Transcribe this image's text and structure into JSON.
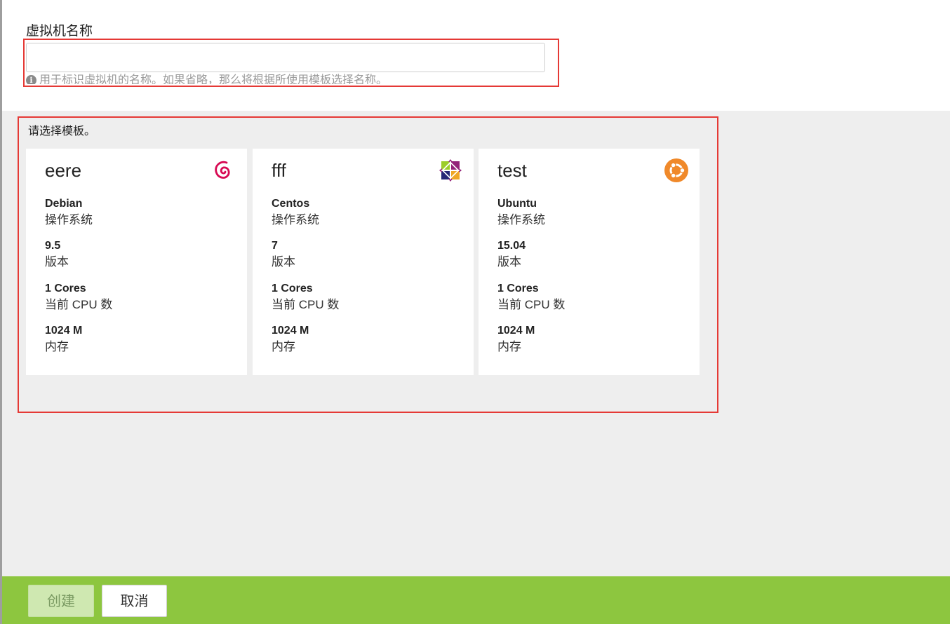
{
  "form": {
    "name_label": "虚拟机名称",
    "name_value": "",
    "name_placeholder": "",
    "hint_icon": "info-icon",
    "hint_text": "用于标识虚拟机的名称。如果省略，那么将根据所使用模板选择名称。"
  },
  "templates": {
    "prompt": "请选择模板。",
    "cards": [
      {
        "name": "eere",
        "icon": "debian-icon",
        "os": "Debian",
        "os_label": "操作系统",
        "version": "9.5",
        "version_label": "版本",
        "cpu": "1 Cores",
        "cpu_label": "当前 CPU 数",
        "memory": "1024 M",
        "memory_label": "内存"
      },
      {
        "name": "fff",
        "icon": "centos-icon",
        "os": "Centos",
        "os_label": "操作系统",
        "version": "7",
        "version_label": "版本",
        "cpu": "1 Cores",
        "cpu_label": "当前 CPU 数",
        "memory": "1024 M",
        "memory_label": "内存"
      },
      {
        "name": "test",
        "icon": "ubuntu-icon",
        "os": "Ubuntu",
        "os_label": "操作系统",
        "version": "15.04",
        "version_label": "版本",
        "cpu": "1 Cores",
        "cpu_label": "当前 CPU 数",
        "memory": "1024 M",
        "memory_label": "内存"
      }
    ]
  },
  "footer": {
    "create_label": "创建",
    "cancel_label": "取消"
  },
  "colors": {
    "footer_bg": "#8dc63f",
    "highlight_border": "#e53935",
    "debian": "#d70a53",
    "ubuntu": "#f0892a"
  }
}
